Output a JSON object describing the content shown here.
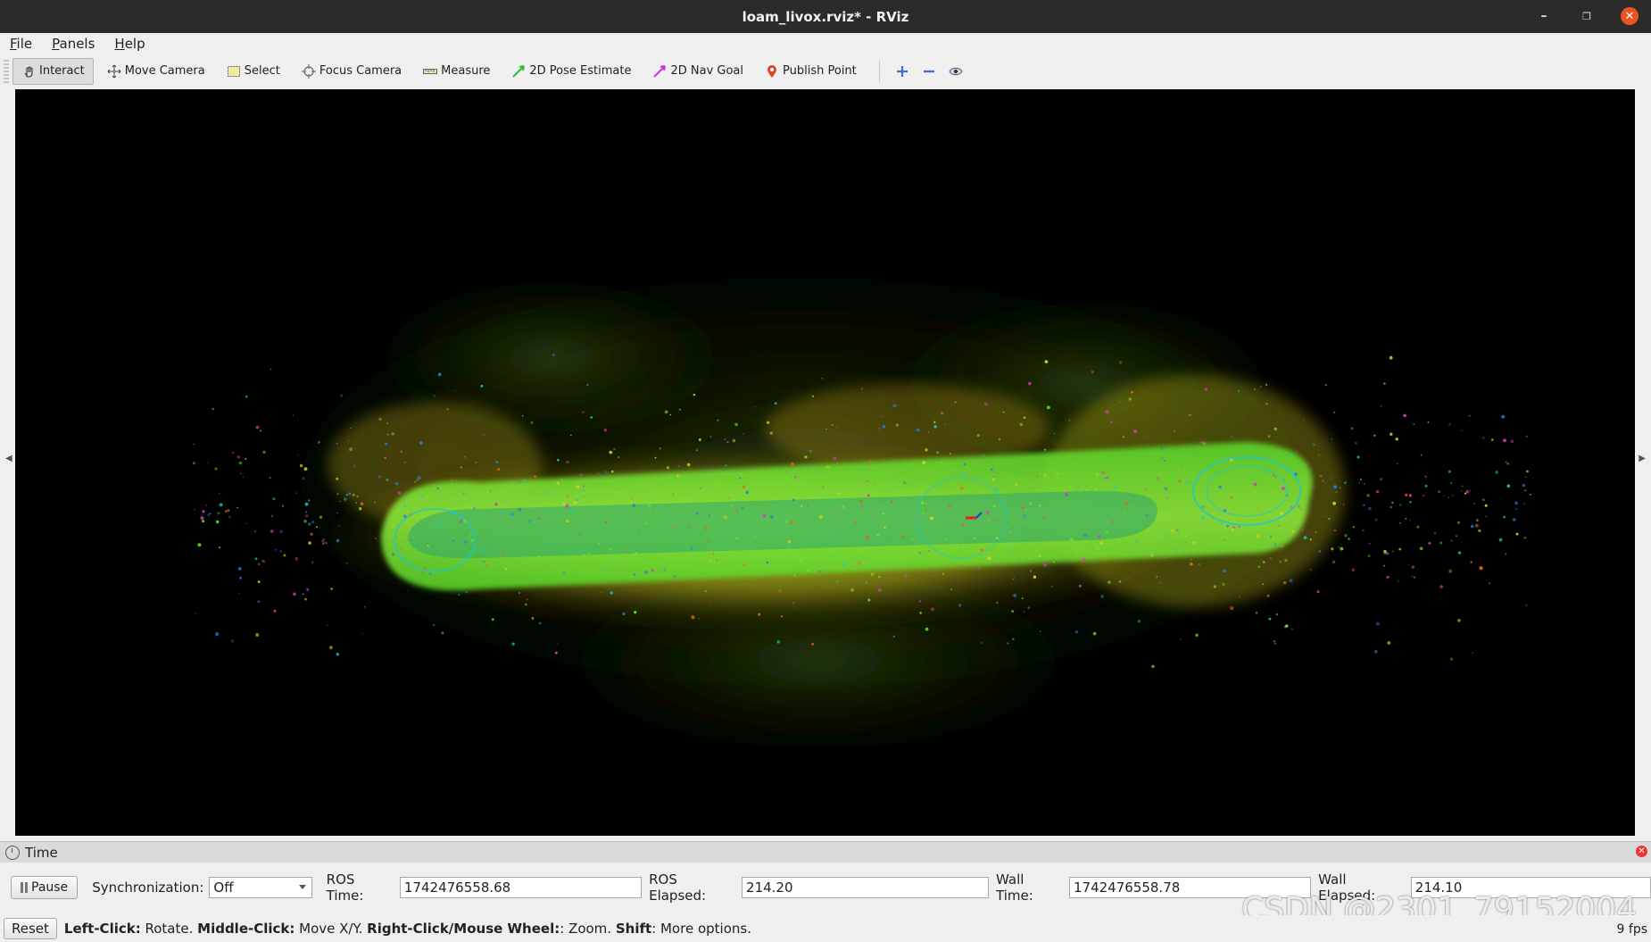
{
  "window": {
    "title": "loam_livox.rviz* - RViz",
    "minimize_icon": "minimize-icon",
    "maximize_icon": "maximize-icon",
    "close_icon": "close-icon"
  },
  "menubar": {
    "items": [
      {
        "label": "File",
        "accel": "F",
        "rest": "ile"
      },
      {
        "label": "Panels",
        "accel": "P",
        "rest": "anels"
      },
      {
        "label": "Help",
        "accel": "H",
        "rest": "elp"
      }
    ]
  },
  "toolbar": {
    "interact": "Interact",
    "move_camera": "Move Camera",
    "select": "Select",
    "focus_camera": "Focus Camera",
    "measure": "Measure",
    "pose_estimate": "2D Pose Estimate",
    "nav_goal": "2D Nav Goal",
    "publish_point": "Publish Point",
    "add_icon": "plus-icon",
    "remove_icon": "minus-icon",
    "view_icon": "eye-icon"
  },
  "time_panel": {
    "title": "Time",
    "pause_label": "Pause",
    "sync_label": "Synchronization:",
    "sync_value": "Off",
    "ros_time_label": "ROS Time:",
    "ros_time": "1742476558.68",
    "ros_elapsed_label": "ROS Elapsed:",
    "ros_elapsed": "214.20",
    "wall_time_label": "Wall Time:",
    "wall_time": "1742476558.78",
    "wall_elapsed_label": "Wall Elapsed:",
    "wall_elapsed": "214.10"
  },
  "statusbar": {
    "reset_label": "Reset",
    "left_click": "Left-Click:",
    "left_click_desc": " Rotate. ",
    "middle_click": "Middle-Click:",
    "middle_click_desc": " Move X/Y. ",
    "right_click": "Right-Click/Mouse Wheel:",
    "right_click_desc": ": Zoom. ",
    "shift": "Shift",
    "shift_desc": ": More options.",
    "fps": "9 fps"
  },
  "watermark": "CSDN @2301_79152004",
  "colors": {
    "titlebar": "#2b2b2b",
    "close_button": "#e95420",
    "viewport_bg": "#000000",
    "cloud_green": "#6ee61e",
    "cloud_yellow": "#d9d21c",
    "cloud_orange": "#e06a14",
    "cloud_cyan": "#1ec8c8"
  }
}
